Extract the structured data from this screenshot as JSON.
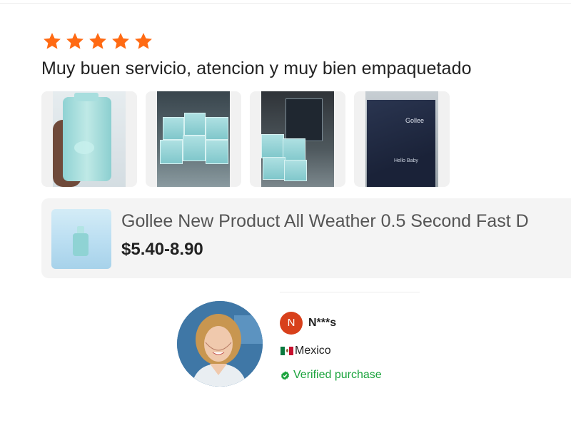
{
  "review": {
    "rating": 5,
    "star_color": "#ff6a13",
    "text": "Muy buen servicio, atencion y muy bien empaquetado",
    "photos": [
      "review-photo-bottle",
      "review-photo-boxes",
      "review-photo-boxes-dark",
      "review-photo-gift-box"
    ]
  },
  "product": {
    "title": "Gollee New Product All Weather 0.5 Second Fast D",
    "price": "$5.40-8.90"
  },
  "reviewer": {
    "initial": "N",
    "initial_color": "#d8401b",
    "name": "N***s",
    "country": "Mexico",
    "verified": "Verified purchase",
    "verified_color": "#1aa33c"
  },
  "photo_labels": {
    "gift_brand": "Gollee",
    "gift_small": "Hello Baby"
  }
}
